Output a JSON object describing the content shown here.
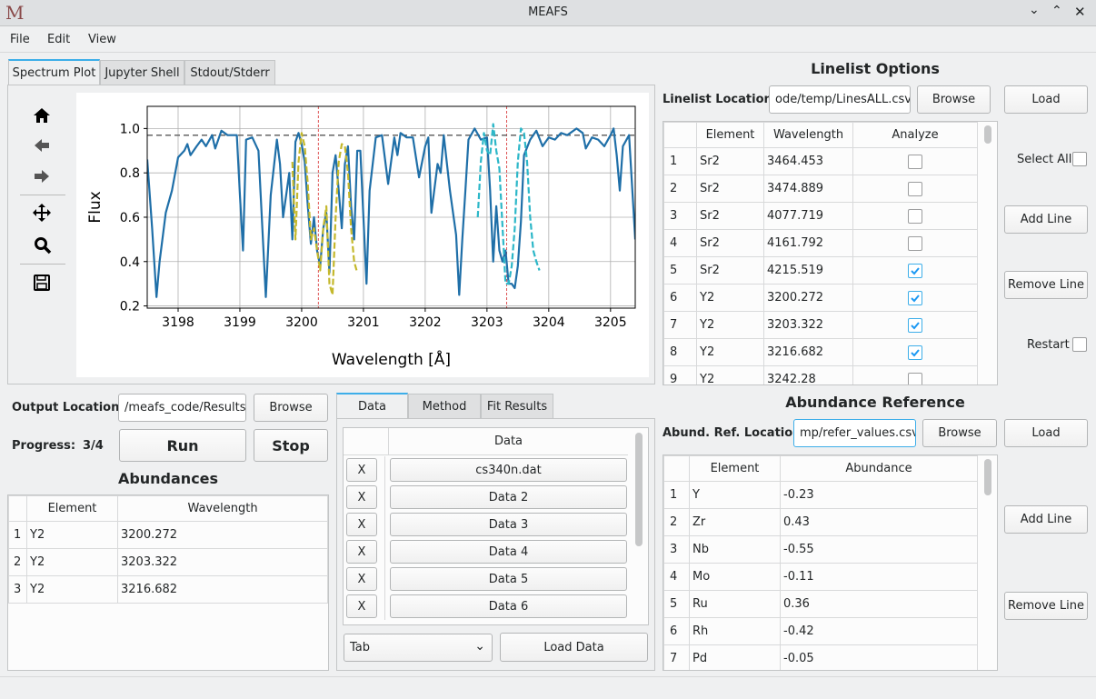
{
  "window": {
    "title": "MEAFS",
    "logo": "M"
  },
  "menu": [
    "File",
    "Edit",
    "View"
  ],
  "plot_tabs": [
    "Spectrum Plot",
    "Jupyter Shell",
    "Stdout/Stderr"
  ],
  "chart_data": {
    "type": "line",
    "xlabel": "Wavelength [Å]",
    "ylabel": "Flux",
    "xlim": [
      3197.5,
      3205.4
    ],
    "ylim": [
      0.19,
      1.1
    ],
    "x_ticks": [
      3198,
      3199,
      3200,
      3201,
      3202,
      3203,
      3204,
      3205
    ],
    "x_tick_labels": [
      "3198",
      "3199",
      "3200",
      "3201",
      "3202",
      "3203",
      "3204",
      "3205"
    ],
    "y_ticks": [
      0.2,
      0.4,
      0.6,
      0.8,
      1.0
    ],
    "y_tick_labels": [
      "0.2",
      "0.4",
      "0.6",
      "0.8",
      "1.0"
    ],
    "continuum": 0.97,
    "vlines": [
      3200.27,
      3203.32
    ],
    "grid": true,
    "series": [
      {
        "style": "solid",
        "color": "#1f6fa8",
        "x": [
          3197.5,
          3197.58,
          3197.65,
          3197.7,
          3197.8,
          3197.9,
          3198.0,
          3198.1,
          3198.15,
          3198.2,
          3198.3,
          3198.38,
          3198.45,
          3198.55,
          3198.6,
          3198.7,
          3198.8,
          3198.95,
          3199.0,
          3199.05,
          3199.1,
          3199.2,
          3199.3,
          3199.42,
          3199.5,
          3199.6,
          3199.65,
          3199.7,
          3199.8,
          3199.85,
          3199.9,
          3199.95,
          3200.0,
          3200.05,
          3200.1,
          3200.15,
          3200.2,
          3200.25,
          3200.3,
          3200.35,
          3200.4,
          3200.45,
          3200.5,
          3200.55,
          3200.6,
          3200.65,
          3200.7,
          3200.75,
          3200.8,
          3200.85,
          3200.9,
          3200.95,
          3201.0,
          3201.05,
          3201.1,
          3201.2,
          3201.3,
          3201.4,
          3201.5,
          3201.55,
          3201.6,
          3201.7,
          3201.8,
          3201.9,
          3202.0,
          3202.05,
          3202.1,
          3202.2,
          3202.25,
          3202.3,
          3202.4,
          3202.5,
          3202.55,
          3202.6,
          3202.65,
          3202.7,
          3202.8,
          3202.9,
          3203.0,
          3203.05,
          3203.1,
          3203.15,
          3203.2,
          3203.25,
          3203.3,
          3203.35,
          3203.4,
          3203.45,
          3203.5,
          3203.55,
          3203.6,
          3203.7,
          3203.8,
          3203.9,
          3204.0,
          3204.1,
          3204.2,
          3204.3,
          3204.45,
          3204.55,
          3204.6,
          3204.7,
          3204.8,
          3204.9,
          3205.0,
          3205.05,
          3205.1,
          3205.15,
          3205.2,
          3205.3,
          3205.4
        ],
        "y": [
          0.86,
          0.55,
          0.24,
          0.4,
          0.62,
          0.72,
          0.87,
          0.9,
          0.93,
          0.88,
          0.92,
          0.95,
          0.92,
          0.97,
          0.91,
          0.99,
          0.97,
          0.97,
          0.7,
          0.45,
          0.95,
          0.96,
          0.9,
          0.24,
          0.7,
          0.95,
          0.84,
          0.6,
          0.8,
          0.5,
          0.94,
          0.98,
          0.93,
          0.85,
          0.65,
          0.48,
          0.6,
          0.45,
          0.38,
          0.55,
          0.62,
          0.35,
          0.8,
          0.88,
          0.72,
          0.55,
          0.84,
          0.92,
          0.65,
          0.5,
          0.9,
          0.9,
          0.6,
          0.3,
          0.72,
          0.96,
          0.97,
          0.75,
          0.96,
          0.88,
          0.98,
          0.96,
          0.96,
          0.78,
          0.92,
          0.96,
          0.62,
          0.84,
          0.8,
          0.97,
          0.72,
          0.52,
          0.25,
          0.5,
          0.72,
          0.95,
          1.0,
          0.95,
          0.96,
          0.72,
          0.4,
          0.65,
          0.45,
          0.4,
          0.45,
          0.3,
          0.3,
          0.28,
          0.38,
          0.58,
          0.88,
          0.95,
          0.99,
          0.92,
          0.96,
          0.95,
          0.98,
          0.97,
          1.0,
          0.98,
          0.91,
          0.96,
          0.95,
          0.92,
          0.97,
          1.0,
          0.88,
          0.72,
          0.92,
          0.97,
          0.5
        ]
      },
      {
        "style": "dashed",
        "color": "#c4b82c",
        "x": [
          3199.85,
          3199.9,
          3199.95,
          3200.0,
          3200.05,
          3200.1,
          3200.15,
          3200.2,
          3200.25,
          3200.3,
          3200.35,
          3200.4,
          3200.45,
          3200.5,
          3200.55,
          3200.6,
          3200.65,
          3200.7,
          3200.75,
          3200.8,
          3200.85,
          3200.9
        ],
        "y": [
          0.85,
          0.5,
          0.85,
          0.98,
          0.92,
          0.75,
          0.5,
          0.55,
          0.45,
          0.36,
          0.55,
          0.65,
          0.3,
          0.25,
          0.6,
          0.85,
          0.93,
          0.92,
          0.8,
          0.55,
          0.4,
          0.35
        ]
      },
      {
        "style": "dashed",
        "color": "#2cb7c8",
        "x": [
          3202.85,
          3202.9,
          3202.95,
          3203.0,
          3203.05,
          3203.1,
          3203.15,
          3203.2,
          3203.3,
          3203.35,
          3203.4,
          3203.45,
          3203.5,
          3203.55,
          3203.6,
          3203.65,
          3203.7,
          3203.75,
          3203.8,
          3203.85
        ],
        "y": [
          0.6,
          0.85,
          0.98,
          0.9,
          0.88,
          1.02,
          0.9,
          0.82,
          0.3,
          0.3,
          0.38,
          0.55,
          0.85,
          1.0,
          0.98,
          0.85,
          0.6,
          0.45,
          0.4,
          0.36
        ]
      }
    ]
  },
  "toolbar_icons": [
    "home-icon",
    "back-arrow-icon",
    "forward-arrow-icon",
    "pan-icon",
    "zoom-icon",
    "save-icon"
  ],
  "linelist": {
    "title": "Linelist Options",
    "location_label": "Linelist Location:",
    "location_value": "ode/temp/LinesALL.csv",
    "browse": "Browse",
    "load": "Load",
    "headers": [
      "Element",
      "Wavelength",
      "Analyze"
    ],
    "rows": [
      {
        "n": "1",
        "element": "Sr2",
        "wavelength": "3464.453",
        "analyze": false
      },
      {
        "n": "2",
        "element": "Sr2",
        "wavelength": "3474.889",
        "analyze": false
      },
      {
        "n": "3",
        "element": "Sr2",
        "wavelength": "4077.719",
        "analyze": false
      },
      {
        "n": "4",
        "element": "Sr2",
        "wavelength": "4161.792",
        "analyze": false
      },
      {
        "n": "5",
        "element": "Sr2",
        "wavelength": "4215.519",
        "analyze": true
      },
      {
        "n": "6",
        "element": "Y2",
        "wavelength": "3200.272",
        "analyze": true
      },
      {
        "n": "7",
        "element": "Y2",
        "wavelength": "3203.322",
        "analyze": true
      },
      {
        "n": "8",
        "element": "Y2",
        "wavelength": "3216.682",
        "analyze": true
      },
      {
        "n": "9",
        "element": "Y2",
        "wavelength": "3242.28",
        "analyze": false
      }
    ],
    "select_all": "Select All",
    "add_line": "Add Line",
    "remove_line": "Remove Line",
    "restart": "Restart"
  },
  "output": {
    "label": "Output Location:",
    "value": "/meafs_code/Results",
    "browse": "Browse",
    "progress_label": "Progress:",
    "progress_value": "3/4",
    "run": "Run",
    "stop": "Stop"
  },
  "abundances": {
    "title": "Abundances",
    "headers": [
      "Element",
      "Wavelength"
    ],
    "rows": [
      {
        "n": "1",
        "element": "Y2",
        "wavelength": "3200.272"
      },
      {
        "n": "2",
        "element": "Y2",
        "wavelength": "3203.322"
      },
      {
        "n": "3",
        "element": "Y2",
        "wavelength": "3216.682"
      }
    ]
  },
  "data_tabs": [
    "Data",
    "Method",
    "Fit Results"
  ],
  "data_panel": {
    "header": "Data",
    "remove": "X",
    "rows": [
      "cs340n.dat",
      "Data 2",
      "Data 3",
      "Data 4",
      "Data 5",
      "Data 6"
    ],
    "separator": "Tab",
    "load_data": "Load Data"
  },
  "abund_ref": {
    "title": "Abundance Reference",
    "location_label": "Abund. Ref. Location:",
    "location_value": "mp/refer_values.csv",
    "browse": "Browse",
    "load": "Load",
    "headers": [
      "Element",
      "Abundance"
    ],
    "rows": [
      {
        "n": "1",
        "element": "Y",
        "abundance": "-0.23"
      },
      {
        "n": "2",
        "element": "Zr",
        "abundance": "0.43"
      },
      {
        "n": "3",
        "element": "Nb",
        "abundance": "-0.55"
      },
      {
        "n": "4",
        "element": "Mo",
        "abundance": "-0.11"
      },
      {
        "n": "5",
        "element": "Ru",
        "abundance": "0.36"
      },
      {
        "n": "6",
        "element": "Rh",
        "abundance": "-0.42"
      },
      {
        "n": "7",
        "element": "Pd",
        "abundance": "-0.05"
      }
    ],
    "add_line": "Add Line",
    "remove_line": "Remove Line"
  }
}
